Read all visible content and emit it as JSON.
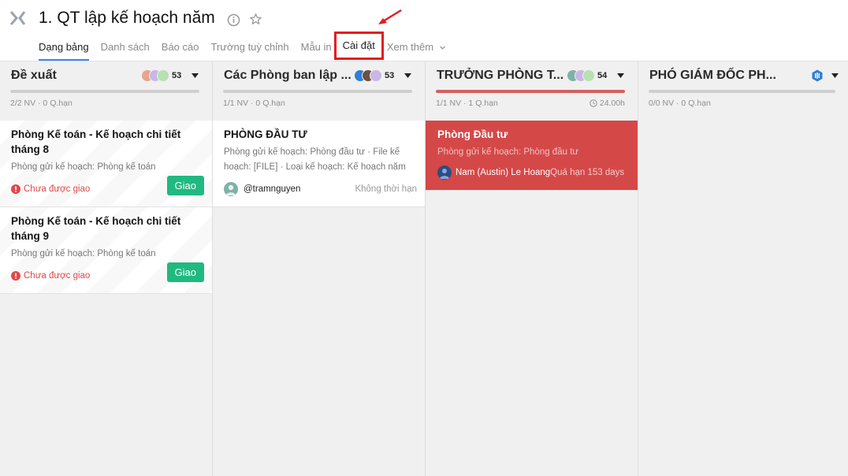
{
  "header": {
    "title": "1. QT lập kế hoạch năm"
  },
  "tabs": [
    {
      "label": "Dạng bảng"
    },
    {
      "label": "Danh sách"
    },
    {
      "label": "Báo cáo"
    },
    {
      "label": "Trường tuỳ chỉnh"
    },
    {
      "label": "Mẫu in"
    },
    {
      "label": "Cài đặt"
    },
    {
      "label": "Xem thêm"
    }
  ],
  "columns": [
    {
      "title": "Đề xuất",
      "count": "53",
      "meta": "2/2 NV · 0 Q.hạn",
      "cards": [
        {
          "title": "Phòng Kế toán - Kế hoạch chi tiết tháng 8",
          "sub": "Phòng gửi kế hoạch: Phòng kế toán",
          "status": "Chưa được giao",
          "button": "Giao"
        },
        {
          "title": "Phòng Kế toán - Kế hoạch chi tiết tháng 9",
          "sub": "Phòng gửi kế hoạch: Phòng kế toán",
          "status": "Chưa được giao",
          "button": "Giao"
        }
      ]
    },
    {
      "title": "Các Phòng ban lập ...",
      "count": "53",
      "meta": "1/1 NV · 0 Q.hạn",
      "cards": [
        {
          "title": "PHÒNG ĐẦU TƯ",
          "sub": "Phòng gửi kế hoạch: Phòng đầu tư · File kế hoạch: [FILE] · Loại kế hoạch: Kế hoạch năm",
          "user": "@tramnguyen",
          "right": "Không thời hạn"
        }
      ]
    },
    {
      "title": "TRƯỞNG PHÒNG T...",
      "count": "54",
      "meta": "1/1 NV · 1 Q.hạn",
      "time": "24.00h",
      "cards": [
        {
          "title": "Phòng Đầu tư",
          "sub": "Phòng gửi kế hoạch: Phòng đầu tư",
          "user": "Nam (Austin) Le Hoang",
          "right": "Quá hạn 153 days"
        }
      ]
    },
    {
      "title": "PHÓ GIÁM ĐỐC PH...",
      "meta": "0/0 NV · 0 Q.hạn"
    }
  ],
  "colors": {
    "accent": "#3b82f6",
    "success": "#1fb981",
    "danger": "#d44848",
    "highlight": "#e51b1b"
  }
}
